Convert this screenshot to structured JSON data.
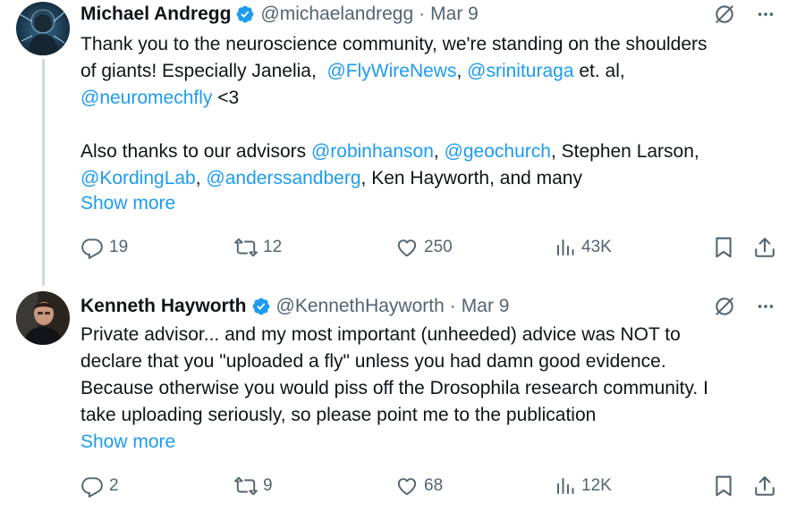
{
  "tweets": [
    {
      "author": "Michael Andregg",
      "handle": "@michaelandregg",
      "separator": "·",
      "date": "Mar 9",
      "body_segments": [
        {
          "text": "Thank you to the neuroscience community, we're standing on the shoulders\nof giants! Especially Janelia,  ",
          "link": false
        },
        {
          "text": "@FlyWireNews",
          "link": true
        },
        {
          "text": ", ",
          "link": false
        },
        {
          "text": "@srinituraga",
          "link": true
        },
        {
          "text": " et. al,\n",
          "link": false
        },
        {
          "text": "@neuromechfly",
          "link": true
        },
        {
          "text": " <3\n\nAlso thanks to our advisors ",
          "link": false
        },
        {
          "text": "@robinhanson",
          "link": true
        },
        {
          "text": ", ",
          "link": false
        },
        {
          "text": "@geochurch",
          "link": true
        },
        {
          "text": ", Stephen Larson,\n",
          "link": false
        },
        {
          "text": "@KordingLab",
          "link": true
        },
        {
          "text": ", ",
          "link": false
        },
        {
          "text": "@anderssandberg",
          "link": true
        },
        {
          "text": ", Ken Hayworth, and many",
          "link": false
        }
      ],
      "show_more": "Show more",
      "replies": "19",
      "reposts": "12",
      "likes": "250",
      "views": "43K"
    },
    {
      "author": "Kenneth Hayworth",
      "handle": "@KennethHayworth",
      "separator": "·",
      "date": "Mar 9",
      "body_segments": [
        {
          "text": "Private advisor... and my most important (unheeded) advice was NOT to\ndeclare that you \"uploaded a fly\" unless you had damn good evidence.\nBecause otherwise you would piss off the Drosophila research community. I\ntake uploading seriously, so please point me to the publication",
          "link": false
        }
      ],
      "show_more": "Show more",
      "replies": "2",
      "reposts": "9",
      "likes": "68",
      "views": "12K"
    }
  ],
  "colors": {
    "link": "#1d9bf0",
    "secondary_text": "#536471",
    "verified_badge": "#1d9bf0",
    "thread_line": "#cfd9de"
  },
  "icons": [
    "verified-badge-icon",
    "grok-icon",
    "more-icon",
    "reply-icon",
    "repost-icon",
    "like-icon",
    "views-icon",
    "bookmark-icon",
    "share-icon"
  ]
}
